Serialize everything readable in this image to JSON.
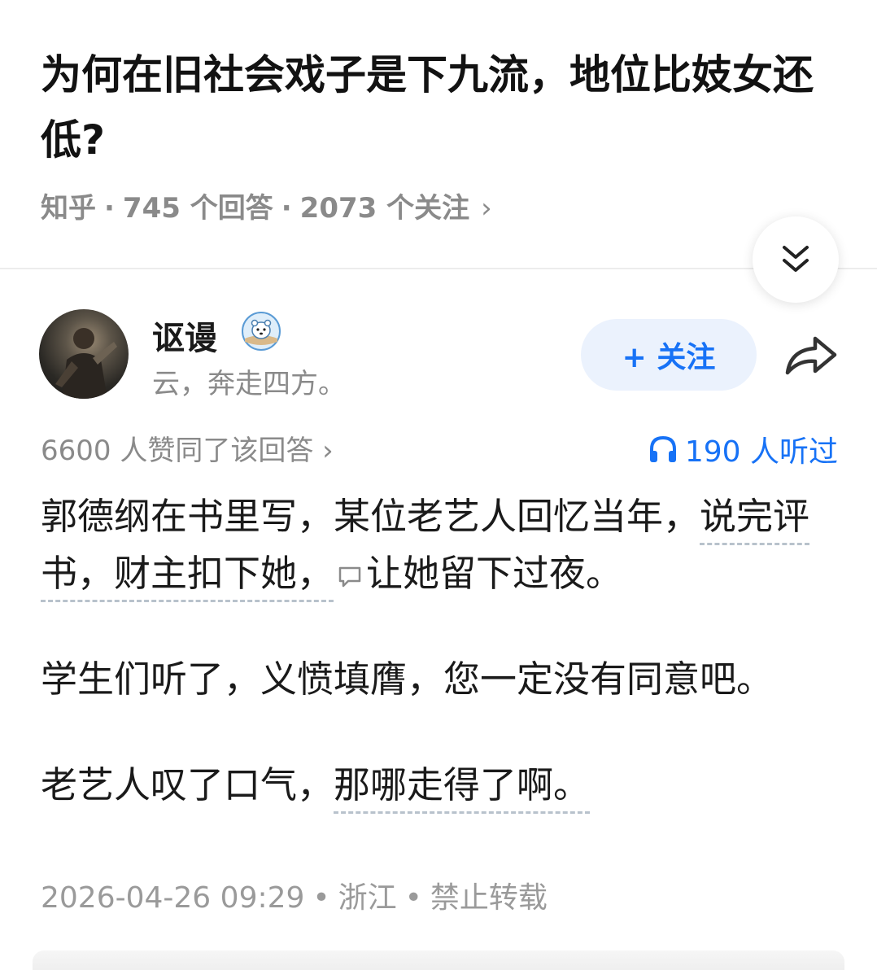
{
  "question": {
    "title": "为何在旧社会戏子是下九流，地位比妓女还低?",
    "source": "知乎",
    "answers": "745 个回答",
    "followers": "2073 个关注",
    "more_chevron": "›"
  },
  "author": {
    "name": "讴谩",
    "bio": "云，奔走四方。",
    "follow_label": "+ 关注"
  },
  "stats": {
    "likes": "6600 人赞同了该回答 ›",
    "listened": "190 人听过"
  },
  "answer": {
    "p1_a": "郭德纲在书里写，某位老艺人回忆当年，",
    "p1_b": "说完评书，财主扣下她，",
    "p1_c": "让她留下过夜。",
    "p2": "学生们听了，义愤填膺，您一定没有同意吧。",
    "p3_a": "老艺人叹了口气，",
    "p3_b": "那哪走得了啊。"
  },
  "footer": {
    "datetime": "2026-04-26 09:29",
    "location": "浙江",
    "rights": "禁止转载",
    "separator": "•"
  },
  "colors": {
    "accent": "#1772f6",
    "follow_bg": "#ebf2fd",
    "meta_gray": "#8a8a8a"
  },
  "icons": {
    "collapse": "double-chevron-down-icon",
    "share": "share-arrow-icon",
    "headphones": "headphones-icon",
    "comment": "comment-bubble-icon",
    "badge": "polar-bear-badge-icon"
  }
}
